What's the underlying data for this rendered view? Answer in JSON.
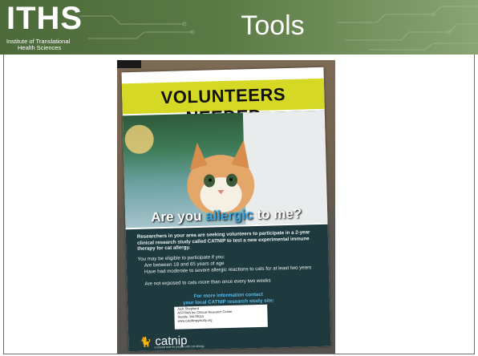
{
  "slide": {
    "logo": {
      "main": "ITHS",
      "sub_line1": "Institute of Translational",
      "sub_line2": "Health Sciences"
    },
    "title": "Tools"
  },
  "poster": {
    "banner": "VOLUNTEERS NEEDED",
    "caption": {
      "part1": "Are you ",
      "highlight": "allergic",
      "part2": " to me?"
    },
    "intro": "Researchers in your area are seeking volunteers to participate in a 2-year clinical research study called CATNIP to test a new experimental immune therapy for cat allergy.",
    "eligibility_heading": "You may be eligible to participate if you:",
    "bullets": [
      "Are between 18 and 65 years of age",
      "Have had moderate to severe allergic reactions to cats for at least two years",
      "Are not exposed to cats more than once every two weeks"
    ],
    "more_info_line1": "For more information contact",
    "more_info_line2": "your local CATNIP research study site:",
    "contact_lines": [
      "Jack Shepherd",
      "ASTHMA Inc Clinical Research Center",
      "Seattle, WA 98115",
      "www.catallergystudy.org"
    ],
    "brand": "catnip",
    "brand_tagline": "a clinical trial for people with cat allergy"
  }
}
